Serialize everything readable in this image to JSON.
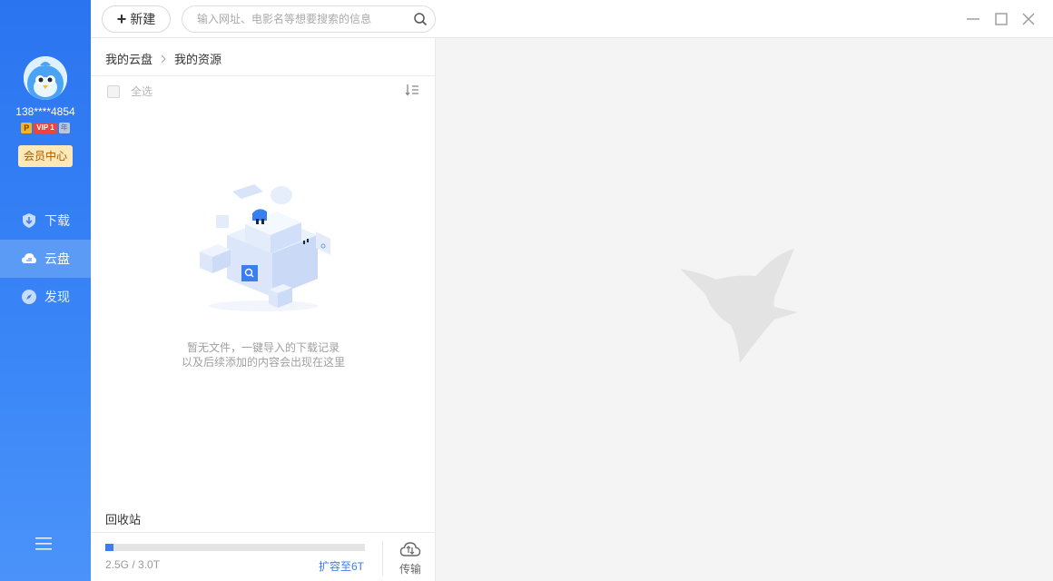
{
  "sidebar": {
    "username": "138****4854",
    "vip_p": "P",
    "vip_label": "VIP 1",
    "vip_year": "年",
    "member_center": "会员中心",
    "nav": [
      {
        "label": "下载",
        "icon": "download-shield-icon",
        "active": false
      },
      {
        "label": "云盘",
        "icon": "cloud-icon",
        "active": true
      },
      {
        "label": "发现",
        "icon": "compass-icon",
        "active": false
      }
    ],
    "menu_icon": "hamburger-menu-icon"
  },
  "topbar": {
    "new_label": "新建",
    "search_placeholder": "输入网址、电影名等想要搜索的信息"
  },
  "panel": {
    "breadcrumb": [
      "我的云盘",
      "我的资源"
    ],
    "select_all": "全选",
    "empty_line1": "暂无文件，一键导入的下载记录",
    "empty_line2": "以及后续添加的内容会出现在这里",
    "recycle_bin": "回收站",
    "storage_text": "2.5G / 3.0T",
    "storage_used_fraction": 0.0083,
    "expand_link": "扩容至6T",
    "transfer_label": "传输"
  },
  "colors": {
    "accent": "#3b7cf2",
    "sidebar_active": "#5b9bf6",
    "member_bg": "#fde8b8"
  }
}
